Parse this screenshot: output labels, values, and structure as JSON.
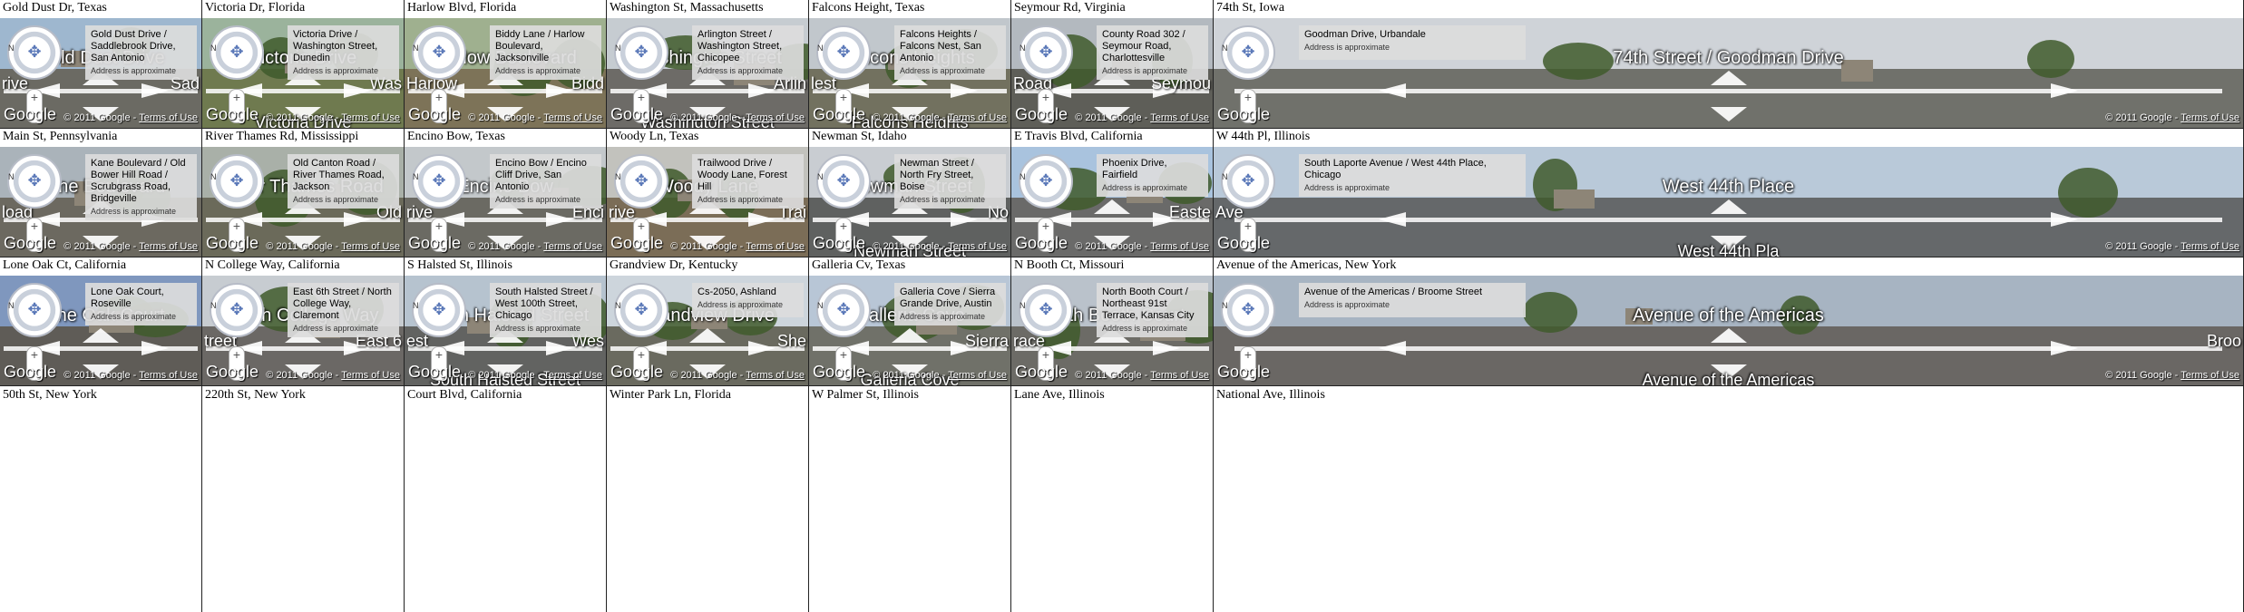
{
  "common": {
    "approx_text": "Address is approximate",
    "copyright_text": "© 2011 Google",
    "terms_text": "Terms of Use",
    "google_logo": "Google",
    "zoom_in": "+",
    "zoom_out": "−"
  },
  "tiles": [
    {
      "title": "Gold Dust Dr, Texas",
      "address": "Gold Dust Drive / Saddlebrook Drive, San Antonio",
      "street_label": "Gold Dust Drive",
      "left_label": "rive",
      "right_label": "Sad",
      "sky": "#9eb7cf",
      "ground": "#6b6a63"
    },
    {
      "title": "Victoria Dr, Florida",
      "address": "Victoria Drive / Washington Street, Dunedin",
      "street_label": "Victoria Drive",
      "left_label": "",
      "right_label": "Was",
      "bottom_label": "Victoria Drive",
      "sky": "#9bb39c",
      "ground": "#6f7a4f"
    },
    {
      "title": "Harlow Blvd, Florida",
      "address": "Biddy Lane / Harlow Boulevard, Jacksonville",
      "street_label": "Harlow Boulevard",
      "left_label": "Harlow",
      "right_label": "Bidd",
      "sky": "#9fb08f",
      "ground": "#7d7358"
    },
    {
      "title": "Washington St, Massachusetts",
      "address": "Arlington Street / Washington Street, Chicopee",
      "street_label": "Washington Street",
      "left_label": "",
      "right_label": "Arlin",
      "bottom_label": "Washington Street",
      "sky": "#c6ccd1",
      "ground": "#6d6b67"
    },
    {
      "title": "Falcons Height, Texas",
      "address": "Falcons Heights / Falcons Nest, San Antonio",
      "street_label": "Falcons Heights",
      "left_label": "lest",
      "right_label": "",
      "bottom_label": "Falcons Heights",
      "sky": "#c1c7cc",
      "ground": "#72715f"
    },
    {
      "title": "Seymour Rd, Virginia",
      "address": "County Road 302 / Seymour Road, Charlottesville",
      "street_label": "",
      "left_label": "Road",
      "right_label": "Seymou",
      "sky": "#b3b9bf",
      "ground": "#5e5e58"
    },
    {
      "title": "74th St, Iowa",
      "address": "Goodman Drive, Urbandale",
      "street_label": "74th Street / Goodman Drive",
      "left_label": "",
      "right_label": "",
      "sky": "#cfd3d8",
      "ground": "#70716b"
    },
    {
      "title": "Main St, Pennsylvania",
      "address": "Kane Boulevard / Old Bower Hill Road / Scrubgrass Road, Bridgeville",
      "street_label": "Kane Boulevard",
      "left_label": "load",
      "right_label": "",
      "sky": "#aab3ba",
      "ground": "#6c6960"
    },
    {
      "title": "River Thames Rd, Mississippi",
      "address": "Old Canton Road / River Thames Road, Jackson",
      "street_label": "River Thames Road",
      "left_label": "",
      "right_label": "Old",
      "sky": "#a9b0a8",
      "ground": "#6b6a5a"
    },
    {
      "title": "Encino Bow, Texas",
      "address": "Encino Bow / Encino Cliff Drive, San Antonio",
      "street_label": "Encino Bow",
      "left_label": "rive",
      "right_label": "Enci",
      "sky": "#c3c8cb",
      "ground": "#6b6a63"
    },
    {
      "title": "Woody Ln, Texas",
      "address": "Trailwood Drive / Woody Lane, Forest Hill",
      "street_label": "Woody Lane",
      "left_label": "rive",
      "right_label": "Trai",
      "sky": "#c2c2bd",
      "ground": "#7b6d57"
    },
    {
      "title": "Newman St, Idaho",
      "address": "Newman Street / North Fry Street, Boise",
      "street_label": "Newman Street",
      "left_label": "",
      "right_label": "No",
      "bottom_label": "Newman Street",
      "sky": "#c9cdd2",
      "ground": "#5f6160"
    },
    {
      "title": "E Travis Blvd, California",
      "address": "Phoenix Drive, Fairfield",
      "street_label": "",
      "left_label": "",
      "right_label": "Easte",
      "sky": "#a9c3de",
      "ground": "#6a6a69"
    },
    {
      "title": "W 44th Pl, Illinois",
      "address": "South Laporte Avenue / West 44th Place, Chicago",
      "street_label": "West 44th Place",
      "left_label": "Ave",
      "right_label": "",
      "bottom_label": "West 44th Pla",
      "sky": "#b9c9d9",
      "ground": "#65686a"
    },
    {
      "title": "Lone Oak Ct, California",
      "address": "Lone Oak Court, Roseville",
      "street_label": "Lone Oak Court",
      "left_label": "",
      "right_label": "",
      "sky": "#7f97be",
      "ground": "#5f5c57"
    },
    {
      "title": "N College Way, California",
      "address": "East 6th Street / North College Way, Claremont",
      "street_label": "North College Way",
      "left_label": "treet",
      "right_label": "East 6",
      "sky": "#c7ccd1",
      "ground": "#6b6865"
    },
    {
      "title": "S Halsted St, Illinois",
      "address": "South Halsted Street / West 100th Street, Chicago",
      "street_label": "South Halsted Street",
      "left_label": "est",
      "right_label": "Wes",
      "bottom_label": "South Halsted Street",
      "sky": "#b6c3cf",
      "ground": "#626361"
    },
    {
      "title": "Grandview Dr, Kentucky",
      "address": "Cs-2050, Ashland",
      "street_label": "Grandview Drive",
      "left_label": "",
      "right_label": "She",
      "sky": "#cdd5dc",
      "ground": "#6a6a5f"
    },
    {
      "title": "Galleria Cv, Texas",
      "address": "Galleria Cove / Sierra Grande Drive, Austin",
      "street_label": "Galleria Cove",
      "left_label": "",
      "right_label": "Sierra",
      "bottom_label": "Galleria Cove",
      "sky": "#b8c6d6",
      "ground": "#707169"
    },
    {
      "title": "N Booth Ct, Missouri",
      "address": "North Booth Court / Northeast 91st Terrace, Kansas City",
      "street_label": "North Booth Court",
      "left_label": "race",
      "right_label": "",
      "sky": "#bac2cb",
      "ground": "#6c6b66"
    },
    {
      "title": "Avenue of the Americas, New York",
      "address": "Avenue of the Americas / Broome Street",
      "street_label": "Avenue of the Americas",
      "left_label": "",
      "right_label": "Broo",
      "bottom_label": "Avenue of the Americas",
      "sky": "#a7b4c2",
      "ground": "#6a6764"
    }
  ],
  "bottom_row": [
    "50th St, New York",
    "220th St, New York",
    "Court Blvd, California",
    "Winter Park Ln, Florida",
    "W Palmer St, Illinois",
    "Lane Ave, Illinois",
    "National Ave, Illinois"
  ]
}
